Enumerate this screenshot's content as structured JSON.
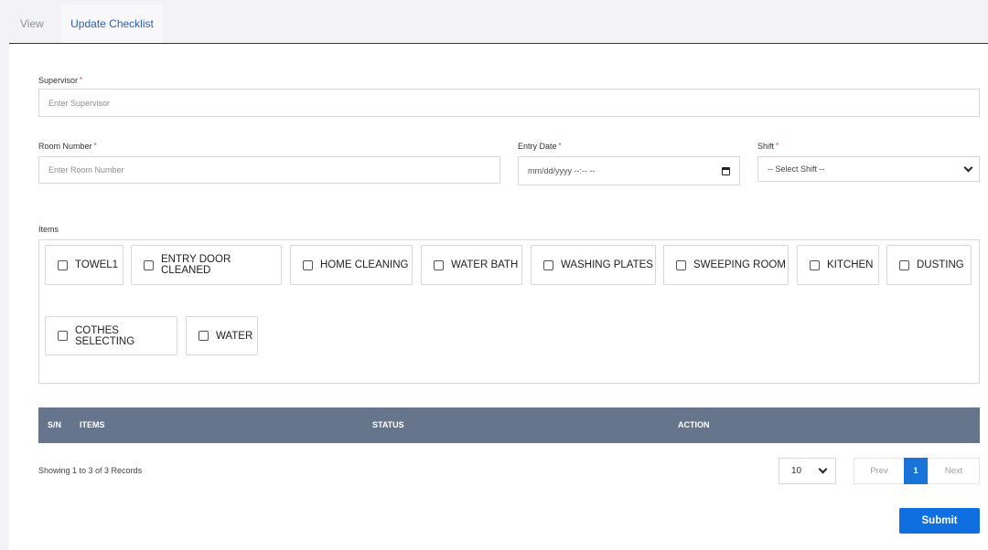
{
  "tabs": [
    {
      "label": "View"
    },
    {
      "label": "Update Checklist"
    }
  ],
  "form": {
    "supervisor": {
      "label": "Supervisor",
      "required_mark": "*",
      "placeholder": "Enter Supervisor",
      "value": ""
    },
    "room_number": {
      "label": "Room Number",
      "required_mark": "*",
      "placeholder": "Enter Room Number",
      "value": ""
    },
    "entry_date": {
      "label": "Entry Date",
      "required_mark": "*",
      "value": "mm/dd/yyyy --:-- --"
    },
    "shift": {
      "label": "Shift",
      "required_mark": "*",
      "selected": "-- Select Shift --"
    },
    "items_label": "Items",
    "items": [
      {
        "label": "TOWEL1",
        "checked": false
      },
      {
        "label": "ENTRY DOOR CLEANED",
        "checked": false
      },
      {
        "label": "HOME CLEANING",
        "checked": false
      },
      {
        "label": "WATER BATH",
        "checked": false
      },
      {
        "label": "WASHING PLATES",
        "checked": false
      },
      {
        "label": "SWEEPING ROOM",
        "checked": false
      },
      {
        "label": "KITCHEN",
        "checked": false
      },
      {
        "label": "DUSTING",
        "checked": false
      },
      {
        "label": "COTHES SELECTING",
        "checked": false
      },
      {
        "label": "WATER",
        "checked": false
      }
    ]
  },
  "table": {
    "columns": [
      "S/N",
      "ITEMS",
      "STATUS",
      "ACTION"
    ],
    "rows": []
  },
  "pagination": {
    "summary": "Showing 1 to 3 of 3 Records",
    "page_size": "10",
    "prev_label": "Prev",
    "current_page": "1",
    "next_label": "Next"
  },
  "submit_label": "Submit",
  "colors": {
    "accent": "#1a73d9",
    "table_header": "#66758c",
    "required": "#e53935"
  }
}
